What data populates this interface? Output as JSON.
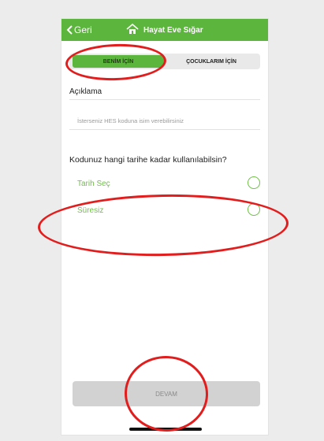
{
  "navbar": {
    "back_label": "Geri",
    "title": "Hayat Eve Sığar",
    "back_icon": "chevron-left-icon",
    "logo_icon": "house-logo-icon"
  },
  "segments": {
    "mine": "BENİM İÇİN",
    "children": "ÇOCUKLARIM İÇİN",
    "selected": "mine"
  },
  "description": {
    "label": "Açıklama",
    "placeholder": "İsterseniz HES koduna isim verebilirsiniz",
    "value": ""
  },
  "validity": {
    "question": "Kodunuz hangi tarihe kadar kullanılabilsin?",
    "options": [
      {
        "label": "Tarih Seç",
        "selected": false
      },
      {
        "label": "Süresiz",
        "selected": false
      }
    ]
  },
  "continue_label": "DEVAM",
  "colors": {
    "brand_green": "#5cb53c",
    "option_green": "#6fc046",
    "annotation_red": "#e21d1d"
  }
}
